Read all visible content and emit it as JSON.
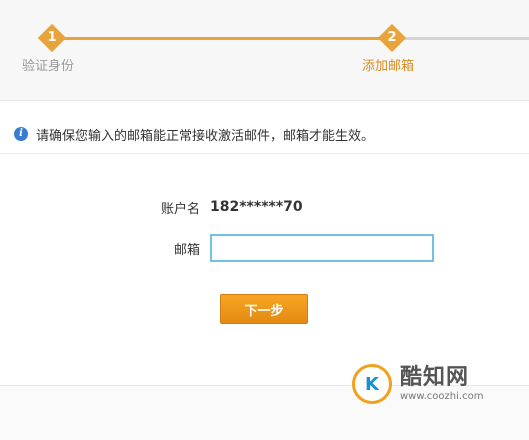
{
  "steps": [
    {
      "number": "1",
      "label": "验证身份"
    },
    {
      "number": "2",
      "label": "添加邮箱"
    }
  ],
  "notice": {
    "text": "请确保您输入的邮箱能正常接收激活邮件，邮箱才能生效。"
  },
  "form": {
    "account_label": "账户名",
    "account_value": "182******70",
    "email_label": "邮箱",
    "email_value": "",
    "next_label": "下一步"
  },
  "watermark": {
    "logo_text": "K",
    "name": "酷知网",
    "url": "www.coozhi.com"
  },
  "colors": {
    "accent": "#e9a33b",
    "info": "#3a7bd5",
    "input_border": "#6fc3e8"
  }
}
